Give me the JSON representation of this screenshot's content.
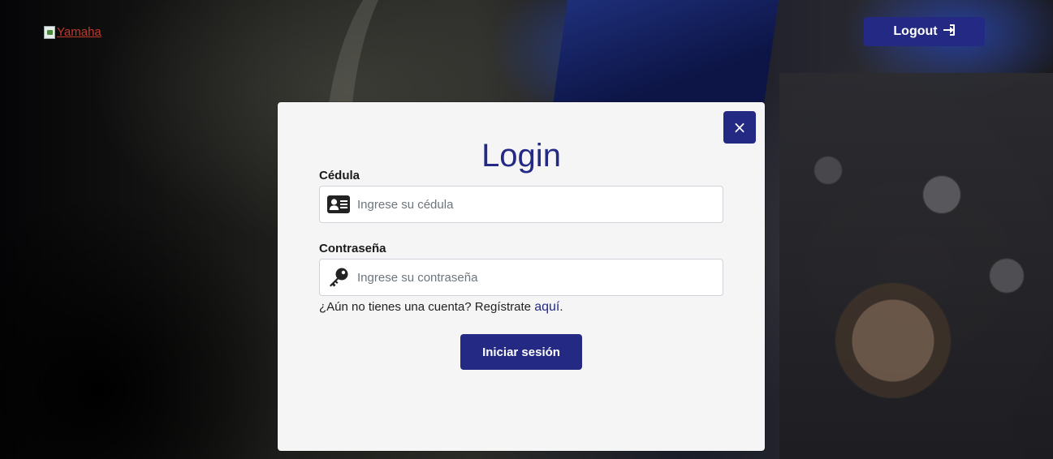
{
  "header": {
    "logo_alt": "Yamaha",
    "logout_label": "Logout"
  },
  "modal": {
    "title": "Login",
    "close_label": "×",
    "fields": {
      "cedula": {
        "label": "Cédula",
        "placeholder": "Ingrese su cédula",
        "value": "",
        "icon": "id-card-icon"
      },
      "password": {
        "label": "Contraseña",
        "placeholder": "Ingrese su contraseña",
        "value": "",
        "icon": "key-icon"
      }
    },
    "register_prompt": "¿Aún no tienes una cuenta? Regístrate",
    "register_link": "aquí",
    "register_suffix": ".",
    "submit_label": "Iniciar sesión"
  },
  "colors": {
    "primary": "#242a84",
    "modal_bg": "#f5f5f6",
    "logo_link": "#c0392b"
  }
}
